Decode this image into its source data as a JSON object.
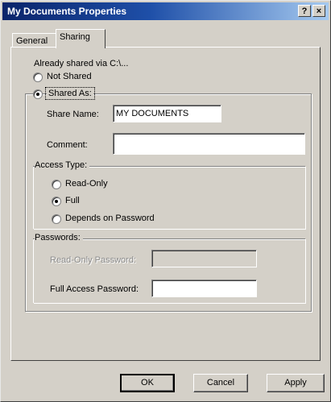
{
  "window": {
    "title": "My Documents Properties",
    "help_label": "?",
    "close_label": "×"
  },
  "tabs": [
    {
      "label": "General"
    },
    {
      "label": "Sharing"
    }
  ],
  "sharing": {
    "already_shared": "Already shared via C:\\...",
    "not_shared": "Not Shared",
    "shared_as": "Shared As:",
    "share_name_label": "Share Name:",
    "share_name_value": "MY DOCUMENTS",
    "comment_label": "Comment:",
    "comment_value": "",
    "access_type_label": "Access Type:",
    "read_only": "Read-Only",
    "full": "Full",
    "depends_on_password": "Depends on Password",
    "passwords_label": "Passwords:",
    "read_only_password_label": "Read-Only Password:",
    "full_access_password_label": "Full Access Password:"
  },
  "buttons": {
    "ok": "OK",
    "cancel": "Cancel",
    "apply": "Apply"
  }
}
